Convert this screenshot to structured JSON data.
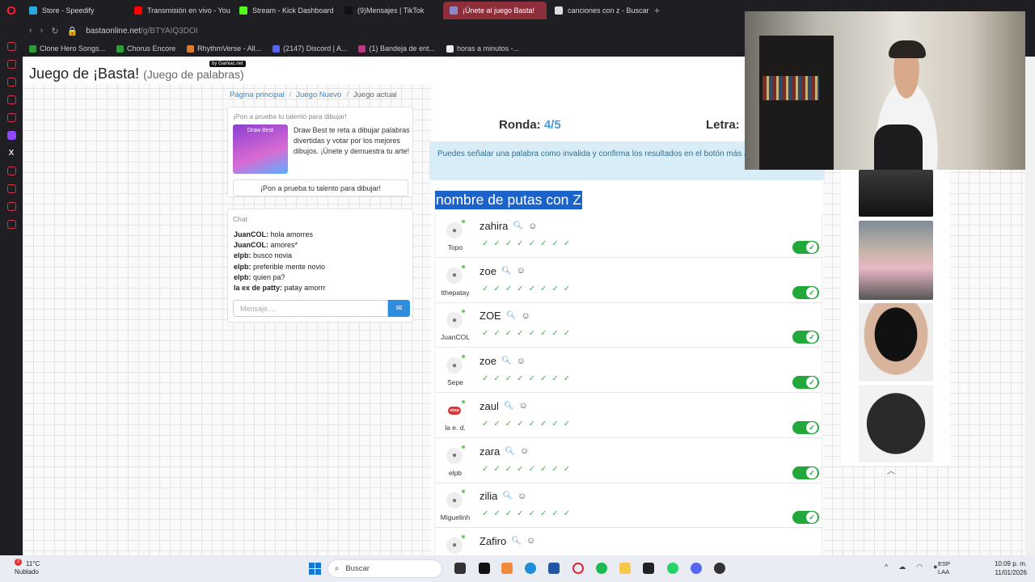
{
  "browser": {
    "tabs": [
      {
        "label": "Store - Speedify",
        "color": "#2aa8e0",
        "active": false
      },
      {
        "label": "Transmisión en vivo - You",
        "color": "#ff0000",
        "active": false
      },
      {
        "label": "Stream - Kick Dashboard",
        "color": "#53fc18",
        "active": false
      },
      {
        "label": "(9)Mensajes | TikTok",
        "color": "#111111",
        "active": false
      },
      {
        "label": "¡Únete al juego Basta!",
        "color": "#8a8acb",
        "active": true
      },
      {
        "label": "canciones con z - Buscar",
        "color": "#dddddd",
        "active": false
      }
    ],
    "url_host": "bastaonline.net",
    "url_path": "/g/BTYAIQ3DOI",
    "bookmarks": [
      {
        "label": "Clone Hero Songs...",
        "color": "#2e9b3c"
      },
      {
        "label": "Chorus Encore",
        "color": "#2e9b3c"
      },
      {
        "label": "RhythmVerse - All...",
        "color": "#e07b2b"
      },
      {
        "label": "(2147) Discord | A...",
        "color": "#5865f2"
      },
      {
        "label": "(1) Bandeja de ent...",
        "color": "#c13584"
      },
      {
        "label": "horas a minutos -...",
        "color": "#eeeeee"
      }
    ]
  },
  "header": {
    "title": "Juego de ¡Basta!",
    "subtitle": "(Juego de palabras)",
    "badge": "by Gamiac.net"
  },
  "breadcrumb": [
    "Página principal",
    "Juego Nuevo",
    "Juego actual"
  ],
  "promo": {
    "title": "¡Pon a prueba tu talento para dibujar!",
    "image_label": "Draw Best",
    "text": "Draw Best te reta a dibujar palabras divertidas y votar por los mejores dibujos. ¡Únete y demuestra tu arte!",
    "button": "¡Pon a prueba tu talento para dibujar!"
  },
  "chat": {
    "title": "Chat",
    "messages": [
      {
        "user": "JuanCOL:",
        "text": "hola amorres"
      },
      {
        "user": "JuanCOL:",
        "text": "amores*"
      },
      {
        "user": "elpb:",
        "text": "busco novia"
      },
      {
        "user": "elpb:",
        "text": "preferible mente novio"
      },
      {
        "user": "elpb:",
        "text": "quien pa?"
      },
      {
        "user": "la ex de patty:",
        "text": "patay amorrr"
      }
    ],
    "placeholder": "Mensaje...."
  },
  "game": {
    "round_label": "Ronda:",
    "round_value": "4/5",
    "letter_label": "Letra:",
    "info": "Puedes señalar una palabra como invalida y confirma los resultados en el botón más abajo.",
    "category": "nombre de putas con Z",
    "players": [
      {
        "word": "zahira",
        "user": "Topo",
        "avatar": "person"
      },
      {
        "word": "zoe",
        "user": "tthepatay",
        "avatar": "person"
      },
      {
        "word": "ZOE",
        "user": "JuanCOL",
        "avatar": "person"
      },
      {
        "word": "zoe",
        "user": "Sepe",
        "avatar": "person"
      },
      {
        "word": "zaul",
        "user": "la e. d.",
        "avatar": "stop"
      },
      {
        "word": "zara",
        "user": "elpb",
        "avatar": "person"
      },
      {
        "word": "zilia",
        "user": "Miguelinh",
        "avatar": "person"
      },
      {
        "word": "Zafiro",
        "user": "",
        "avatar": "person"
      }
    ],
    "stop_label": "stop"
  },
  "taskbar": {
    "weather_temp": "11°C",
    "weather_desc": "Nublado",
    "notif_count": "2",
    "search": "Buscar",
    "lang_top": "ESP",
    "lang_bottom": "LAA",
    "time": "10:09 p. m.",
    "date": "11/01/2026"
  }
}
